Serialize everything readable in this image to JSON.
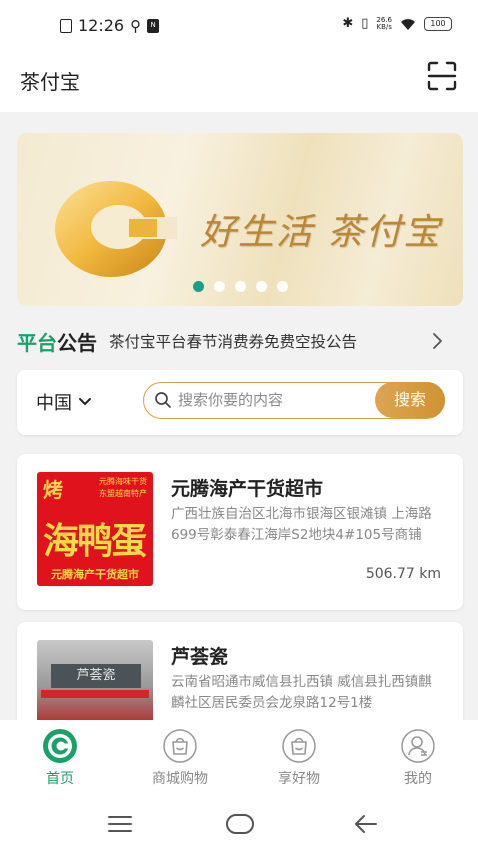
{
  "status_bar": {
    "time": "12:26",
    "net_speed_value": "26.6",
    "net_speed_unit": "KB/s",
    "battery": "100",
    "sim_label": "N"
  },
  "header": {
    "title": "茶付宝",
    "scan_icon": "scan-icon"
  },
  "banner": {
    "slogan": "好生活 茶付宝",
    "slides": 5,
    "active_slide": 0
  },
  "notice": {
    "label_green": "平台",
    "label_black": "公告",
    "text": "茶付宝平台春节消费券免费空投公告"
  },
  "search": {
    "region": "中国",
    "placeholder": "搜索你要的内容",
    "button": "搜索"
  },
  "stores": [
    {
      "name": "元腾海产干货超市",
      "address": "广西壮族自治区北海市银海区银滩镇 上海路699号彰泰春江海岸S2地块4#105号商铺",
      "distance": "506.77 km",
      "image_text": {
        "kao": "烤",
        "title": "海鸭蛋",
        "slogan_1": "元腾海味干货",
        "slogan_2": "东盟越南特产",
        "bottom": "元腾海产干货超市"
      }
    },
    {
      "name": "芦荟瓷",
      "address": "云南省昭通市威信县扎西镇 威信县扎西镇麒麟社区居民委员会龙泉路12号1楼",
      "image_text": {
        "sign": "芦荟瓷"
      }
    }
  ],
  "bottom_nav": [
    {
      "label": "首页",
      "icon": "home-logo-icon",
      "active": true
    },
    {
      "label": "商城购物",
      "icon": "shopping-bag-icon",
      "active": false
    },
    {
      "label": "享好物",
      "icon": "gift-bag-icon",
      "active": false
    },
    {
      "label": "我的",
      "icon": "profile-icon",
      "active": false
    }
  ],
  "colors": {
    "brand_green": "#1aa06a",
    "search_gold": "#d5a24a",
    "banner_gold": "#b8873a"
  }
}
